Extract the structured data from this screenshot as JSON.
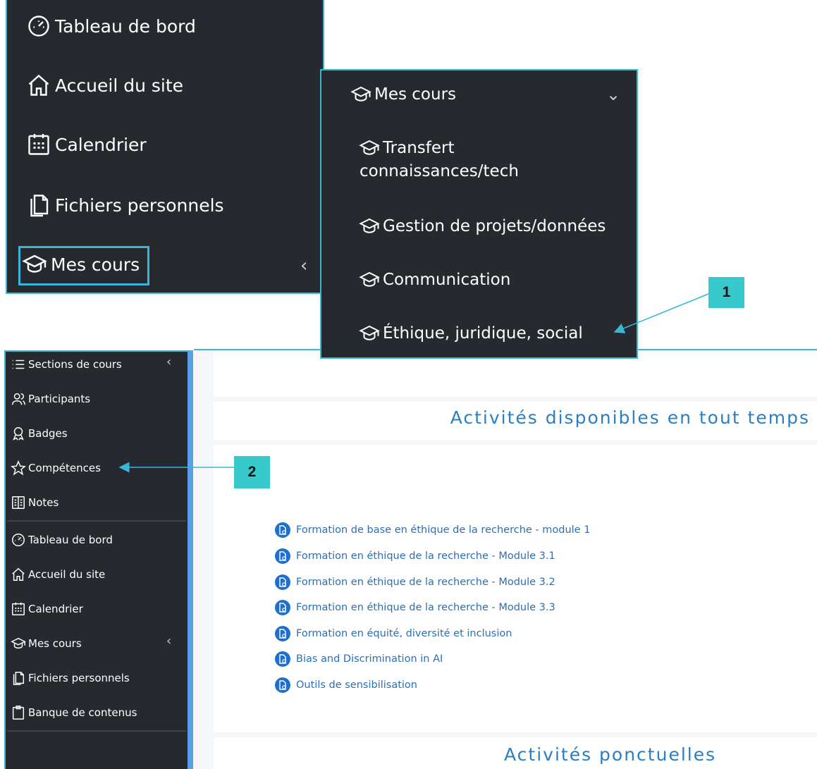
{
  "menu_top": {
    "items": [
      {
        "label": "Tableau de bord",
        "icon": "dashboard-icon"
      },
      {
        "label": "Accueil du site",
        "icon": "home-icon"
      },
      {
        "label": "Calendrier",
        "icon": "calendar-icon"
      },
      {
        "label": "Fichiers personnels",
        "icon": "files-icon"
      },
      {
        "label": "Mes cours",
        "icon": "graduation-cap-icon"
      }
    ],
    "chevron": "‹"
  },
  "submenu": {
    "header": "Mes cours",
    "chevron": "⌄",
    "items": [
      {
        "line1": "Transfert",
        "line2": "connaissances/tech"
      },
      {
        "label": "Gestion de projets/données"
      },
      {
        "label": "Communication"
      },
      {
        "label": "Éthique, juridique, social"
      }
    ]
  },
  "callouts": {
    "one": "1",
    "two": "2"
  },
  "sidebar": {
    "course_items": [
      {
        "label": "Sections de cours",
        "icon": "list-icon",
        "chevron": "‹"
      },
      {
        "label": "Participants",
        "icon": "participants-icon"
      },
      {
        "label": "Badges",
        "icon": "badge-icon"
      },
      {
        "label": "Compétences",
        "icon": "star-icon"
      },
      {
        "label": "Notes",
        "icon": "grades-icon"
      }
    ],
    "site_items": [
      {
        "label": "Tableau de bord",
        "icon": "dashboard-icon"
      },
      {
        "label": "Accueil du site",
        "icon": "home-icon"
      },
      {
        "label": "Calendrier",
        "icon": "calendar-icon"
      },
      {
        "label": "Mes cours",
        "icon": "graduation-cap-icon",
        "chevron": "‹"
      },
      {
        "label": "Fichiers personnels",
        "icon": "files-icon"
      },
      {
        "label": "Banque de contenus",
        "icon": "clipboard-icon"
      }
    ]
  },
  "main": {
    "section1_title": "Activités disponibles en tout temps",
    "section2_title": "Activités ponctuelles",
    "activities": [
      "Formation de base en éthique de la recherche - module 1",
      "Formation en éthique de la recherche - Module 3.1",
      "Formation en éthique de la recherche - Module 3.2",
      "Formation en éthique de la recherche - Module 3.3",
      "Formation en équité, diversité et inclusion",
      "Bias and Discrimination in AI",
      "Outils de sensibilisation"
    ]
  },
  "colors": {
    "panel_bg": "#262a2e",
    "highlight_border": "#38b6d8",
    "callout_bg": "#38c9cc",
    "link": "#2b6fb6",
    "title": "#2a7fc4"
  }
}
